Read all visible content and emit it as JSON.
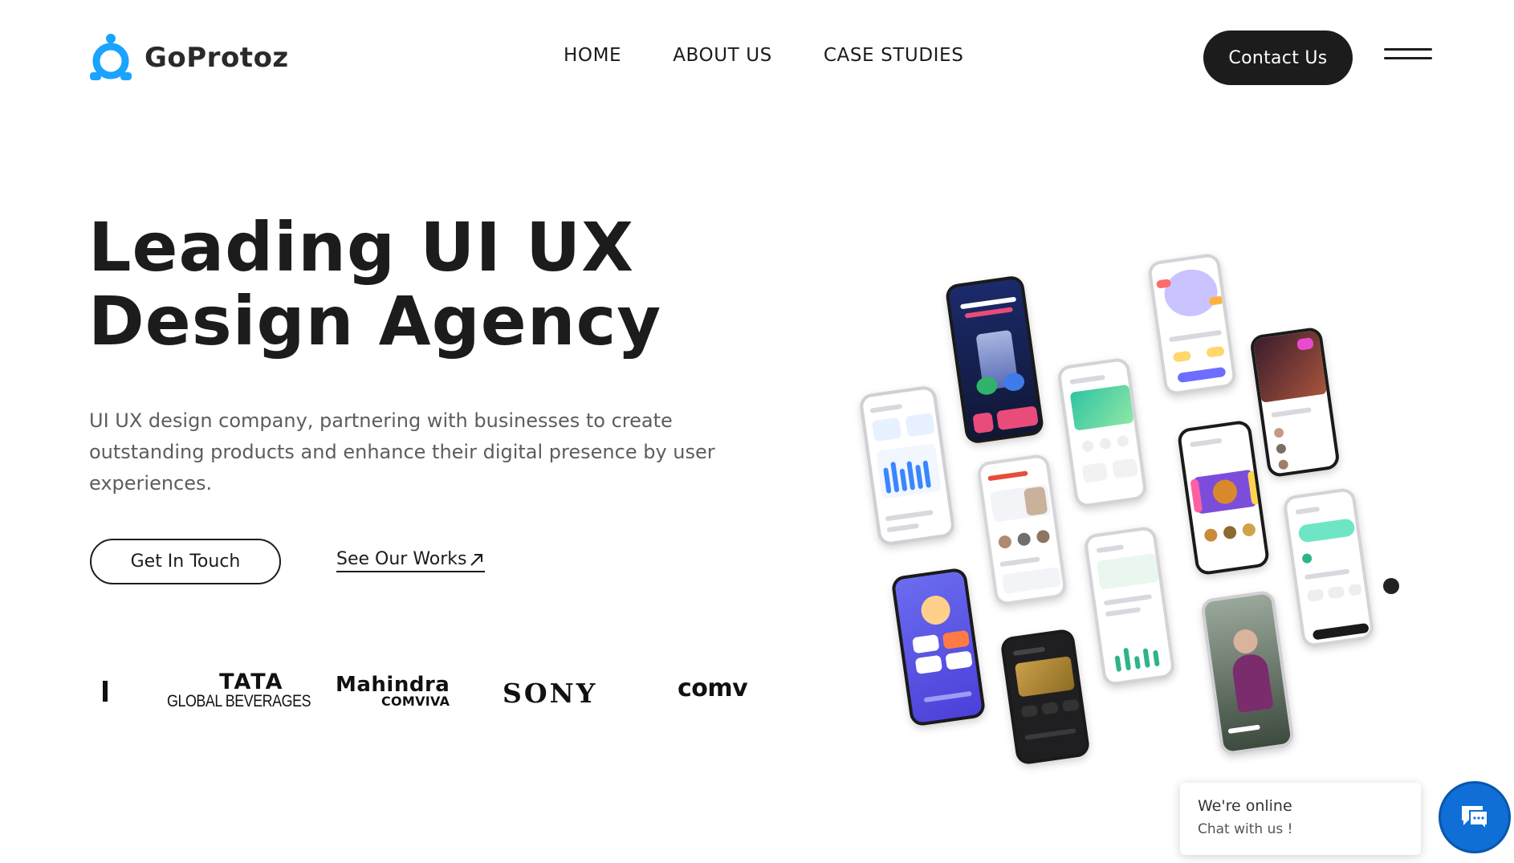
{
  "brand": {
    "name": "GoProtoz",
    "accent": "#1aa3ff",
    "dark": "#1c1c1c"
  },
  "nav": {
    "items": [
      {
        "label": "HOME"
      },
      {
        "label": "ABOUT US"
      },
      {
        "label": "CASE STUDIES"
      }
    ],
    "contact_label": "Contact Us",
    "menu_icon": "hamburger-icon"
  },
  "hero": {
    "title_line1": "Leading UI UX",
    "title_line2": "Design Agency",
    "description": "UI UX design company, partnering with businesses to create outstanding products and enhance their digital presence by user experiences.",
    "primary_cta": "Get In Touch",
    "secondary_cta": "See Our Works",
    "secondary_icon": "arrow-up-right-icon"
  },
  "clients": {
    "tata_line1": "TATA",
    "tata_line2": "GLOBAL BEVERAGES",
    "mahindra_line1": "Mahindra",
    "mahindra_line2": "COMVIVA",
    "sony": "SONY",
    "comv": "comv"
  },
  "chat": {
    "status": "We're online",
    "subtitle": "Chat with us !",
    "icon": "chat-icon",
    "color": "#0f6fd6"
  }
}
